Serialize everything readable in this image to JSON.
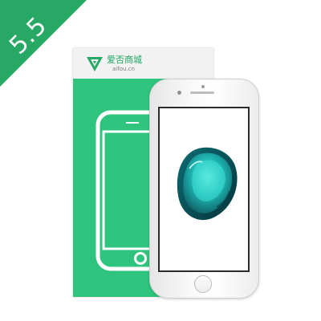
{
  "badge": {
    "text": "5.5",
    "color": "#27a864"
  },
  "box": {
    "brand_name": "爱否商城",
    "brand_url": "aifou.cn",
    "logo_icon": "triangle-v-logo-icon",
    "color": "#2fc47e"
  },
  "phone": {
    "color": "silver",
    "wallpaper": "teal-gem-wallpaper"
  }
}
